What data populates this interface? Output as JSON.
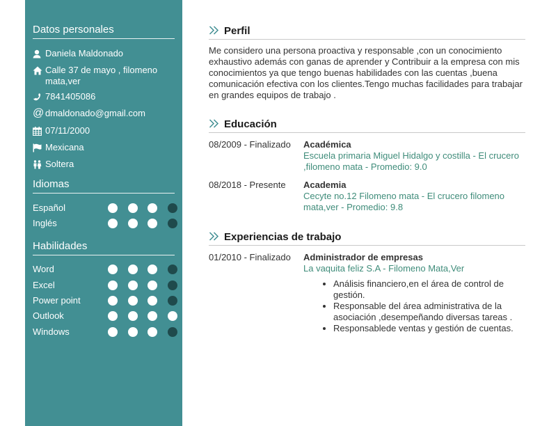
{
  "sidebar": {
    "personal_title": "Datos personales",
    "contact": [
      {
        "icon": "user-icon",
        "text": "Daniela Maldonado"
      },
      {
        "icon": "home-icon",
        "text": "Calle 37 de mayo , filomeno mata,ver"
      },
      {
        "icon": "phone-icon",
        "text": "7841405086"
      },
      {
        "icon": "at-icon",
        "text": "dmaldonado@gmail.com"
      },
      {
        "icon": "calendar-icon",
        "text": "07/11/2000"
      },
      {
        "icon": "flag-icon",
        "text": "Mexicana"
      },
      {
        "icon": "couple-icon",
        "text": "Soltera"
      }
    ],
    "languages_title": "Idiomas",
    "languages": [
      {
        "name": "Español",
        "level": 3,
        "max": 4
      },
      {
        "name": "Inglés",
        "level": 3,
        "max": 4
      }
    ],
    "skills_title": "Habilidades",
    "skills": [
      {
        "name": "Word",
        "level": 3,
        "max": 4
      },
      {
        "name": "Excel",
        "level": 3,
        "max": 4
      },
      {
        "name": "Power point",
        "level": 3,
        "max": 4
      },
      {
        "name": "Outlook",
        "level": 4,
        "max": 4
      },
      {
        "name": "Windows",
        "level": 3,
        "max": 4
      }
    ]
  },
  "main": {
    "profile": {
      "title": "Perfil",
      "text": "Me considero una  persona proactiva  y responsable ,con un conocimiento exhaustivo además con ganas de aprender y Contribuir a la empresa con mis conocimientos ya que tengo buenas habilidades con las cuentas ,buena comunicación efectiva con los clientes.Tengo muchas facilidades para trabajar en grandes equipos de trabajo ."
    },
    "education": {
      "title": "Educación",
      "entries": [
        {
          "date": "08/2009 - Finalizado",
          "title": "Académica",
          "sub": "Escuela primaria Miguel Hidalgo y costilla - El crucero ,filomeno mata - Promedio: 9.0"
        },
        {
          "date": "08/2018 - Presente",
          "title": "Academia",
          "sub": "Cecyte no.12 Filomeno mata - El crucero filomeno mata,ver - Promedio: 9.8"
        }
      ]
    },
    "experience": {
      "title": "Experiencias de trabajo",
      "entries": [
        {
          "date": "01/2010 - Finalizado",
          "title": "Administrador de empresas",
          "sub": "La vaquita feliz S.A - Filomeno Mata,Ver",
          "bullets": [
            "Análisis financiero,en el área  de control de gestión.",
            "Responsable del área administrativa de la asociación ,desempeñando diversas tareas .",
            "Responsablede ventas y gestión de cuentas."
          ]
        }
      ]
    }
  },
  "colors": {
    "sidebar_bg": "#428f93",
    "dot_on": "#ffffff",
    "dot_off": "#1f4a4c",
    "accent_sub": "#3f8c7a",
    "chevron": "#428f93"
  }
}
